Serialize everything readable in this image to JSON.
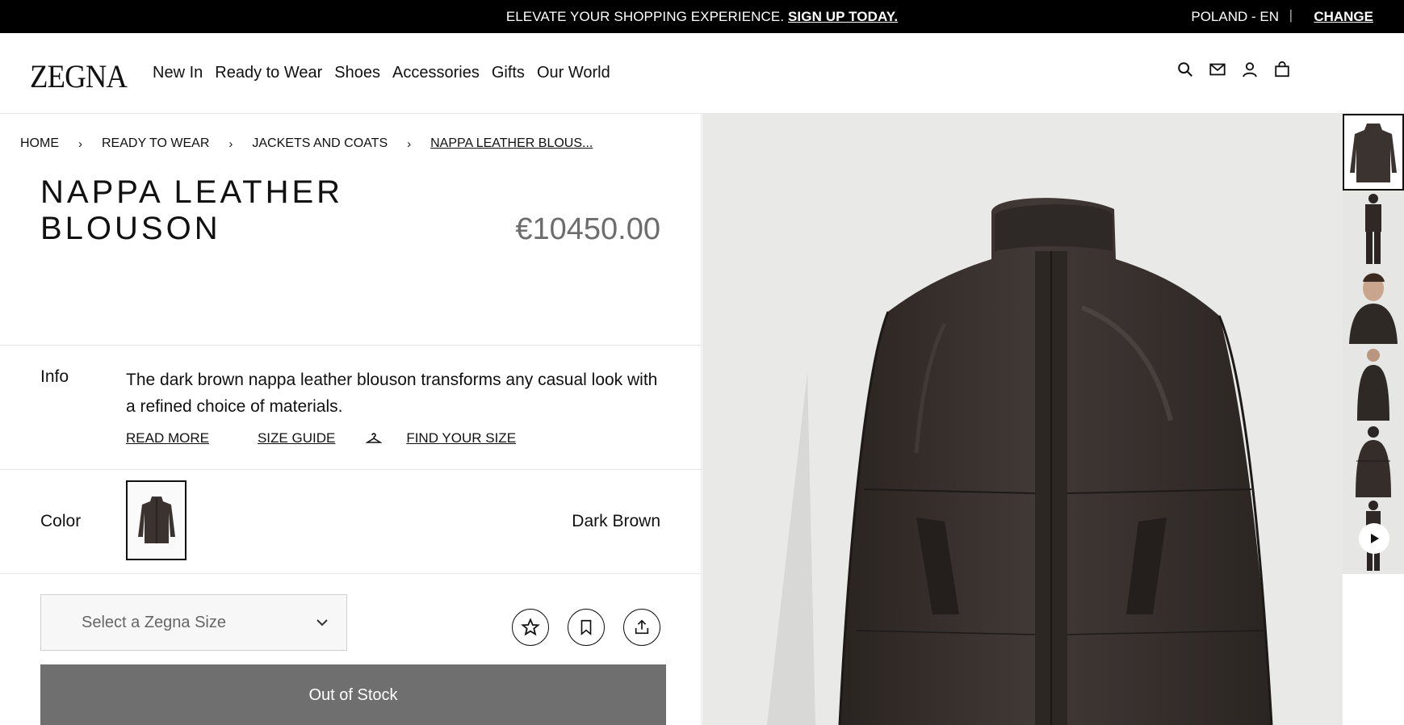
{
  "promo": {
    "text": "ELEVATE YOUR SHOPPING EXPERIENCE.",
    "cta": "SIGN UP TODAY.",
    "locale": "POLAND - EN",
    "separator": "|",
    "change": "CHANGE"
  },
  "header": {
    "logo": "ZEGNA",
    "nav": [
      "New In",
      "Ready to Wear",
      "Shoes",
      "Accessories",
      "Gifts",
      "Our World"
    ],
    "icons": [
      "search-icon",
      "mail-icon",
      "account-icon",
      "bag-icon"
    ]
  },
  "breadcrumb": {
    "items": [
      "HOME",
      "READY TO WEAR",
      "JACKETS AND COATS",
      "NAPPA LEATHER BLOUS..."
    ],
    "separator": "›"
  },
  "product": {
    "title": "NAPPA LEATHER BLOUSON",
    "price": "€10450.00",
    "info_label": "Info",
    "info_text": "The dark brown nappa leather blouson transforms any casual look with a refined choice of materials.",
    "links": {
      "read_more": "READ MORE",
      "size_guide": "SIZE GUIDE",
      "find_size": "FIND YOUR SIZE"
    },
    "color_label": "Color",
    "color_name": "Dark Brown",
    "size_placeholder": "Select a Zegna Size",
    "cta": "Out of Stock"
  },
  "colors": {
    "leather": "#3a3330",
    "leather_dark": "#241f1d",
    "background": "#e9e9e7",
    "button": "#6f6f6f",
    "price": "#6d6d6d"
  }
}
